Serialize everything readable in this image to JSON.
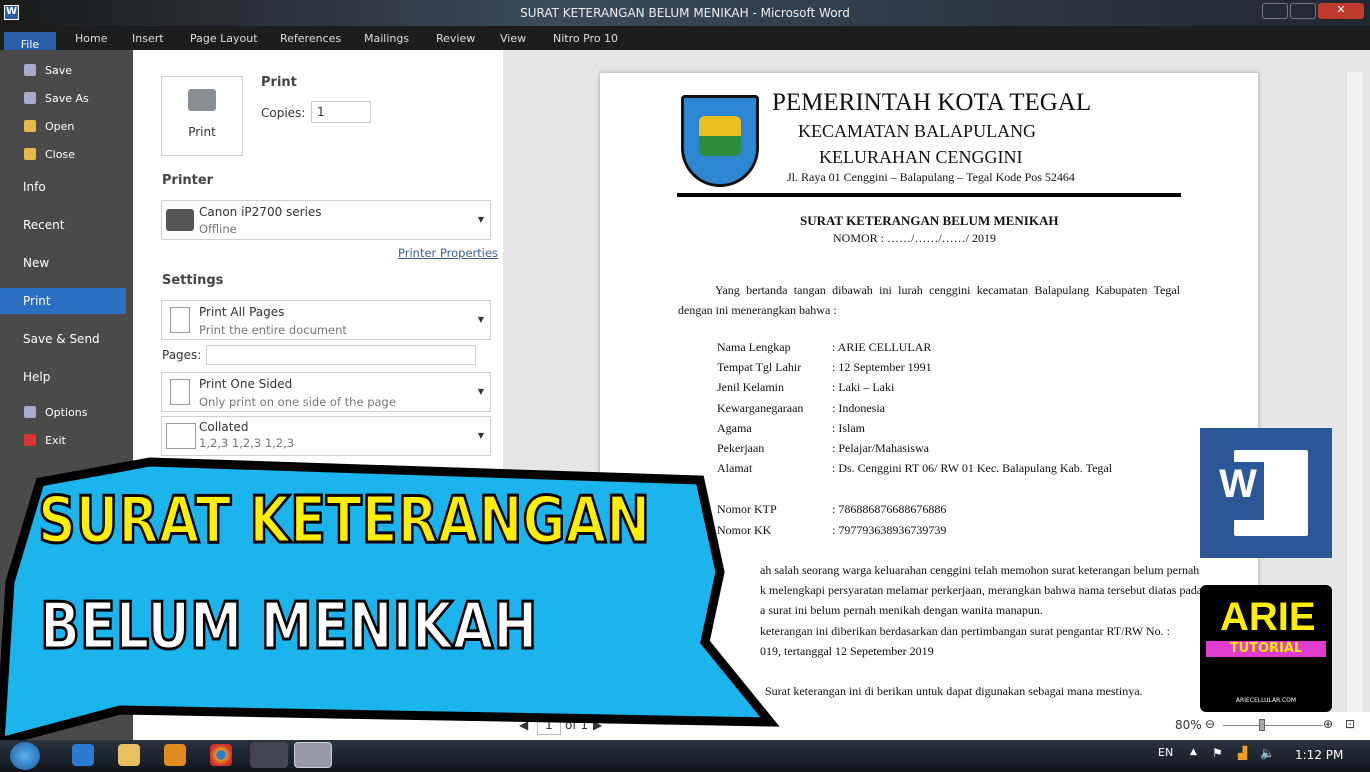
{
  "window": {
    "title": "SURAT KETERANGAN BELUM MENIKAH - Microsoft Word"
  },
  "ribbon": {
    "tabs": [
      "File",
      "Home",
      "Insert",
      "Page Layout",
      "References",
      "Mailings",
      "Review",
      "View",
      "Nitro Pro 10"
    ]
  },
  "backstage": {
    "items": [
      "Save",
      "Save As",
      "Open",
      "Close",
      "Info",
      "Recent",
      "New",
      "Print",
      "Save & Send",
      "Help",
      "Options",
      "Exit"
    ],
    "selected": "Print"
  },
  "print": {
    "heading": "Print",
    "button": "Print",
    "copies_label": "Copies:",
    "copies": "1",
    "printer_heading": "Printer",
    "printer_name": "Canon iP2700 series",
    "printer_status": "Offline",
    "printer_properties": "Printer Properties",
    "settings_heading": "Settings",
    "pages_mode": "Print All Pages",
    "pages_mode_desc": "Print the entire document",
    "pages_label": "Pages:",
    "pages_value": "",
    "sided": "Print One Sided",
    "sided_desc": "Only print on one side of the page",
    "collate": "Collated",
    "collate_desc": "1,2,3   1,2,3   1,2,3"
  },
  "document": {
    "header1": "PEMERINTAH KOTA TEGAL",
    "header2": "KECAMATAN BALAPULANG",
    "header3": "KELURAHAN CENGGINI",
    "address": "Jl. Raya 01 Cenggini – Balapulang – Tegal Kode Pos 52464",
    "title": "SURAT KETERANGAN BELUM MENIKAH",
    "nomor": "NOMOR : ……/……/……/ 2019",
    "intro": "Yang bertanda tangan dibawah ini lurah cenggini kecamatan Balapulang Kabupaten Tegal dengan ini menerangkan bahwa :",
    "fields": [
      {
        "label": "Nama Lengkap",
        "value": ": ARIE CELLULAR"
      },
      {
        "label": "Tempat Tgl Lahir",
        "value": ": 12 September 1991"
      },
      {
        "label": "Jenil Kelamin",
        "value": ": Laki – Laki"
      },
      {
        "label": "Kewarganegaraan",
        "value": ": Indonesia"
      },
      {
        "label": "Agama",
        "value": ": Islam"
      },
      {
        "label": "Pekerjaan",
        "value": ": Pelajar/Mahasiswa"
      },
      {
        "label": "Alamat",
        "value": ": Ds. Cenggini RT 06/ RW 01 Kec. Balapulang Kab. Tegal"
      }
    ],
    "ids": [
      {
        "label": "Nomor KTP",
        "value": ": 786886876688676886"
      },
      {
        "label": "Nomor KK",
        "value": ": 797793638936739739"
      }
    ],
    "p1": "ah salah seorang warga keluarahan cenggini telah memohon surat keterangan belum pernah",
    "p2": "k melengkapi persyaratan melamar perkerjaan, merangkan bahwa nama tersebut diatas pada",
    "p3": "a surat ini belum pernah menikah dengan wanita manapun.",
    "p4": "keterangan ini diberikan berdasarkan dan pertimbangan surat pengantar RT/RW No. :",
    "p5": "019, tertanggal 12 Sepetember 2019",
    "p6": "Surat keterangan ini di berikan untuk dapat digunakan sebagai mana mestinya."
  },
  "status": {
    "page": "1",
    "of": "of 1",
    "zoom": "80%",
    "zoom_level": 80
  },
  "overlay": {
    "line1": "SURAT KETERANGAN",
    "line2": "BELUM MENIKAH",
    "logo_text": "ARIE TUTORIAL",
    "logo_site": "ARIECELLULAR.COM",
    "colors": {
      "blue": "#1cb4ec",
      "yellow": "#ffee00"
    }
  },
  "taskbar": {
    "lang": "EN",
    "clock": "1:12 PM"
  }
}
